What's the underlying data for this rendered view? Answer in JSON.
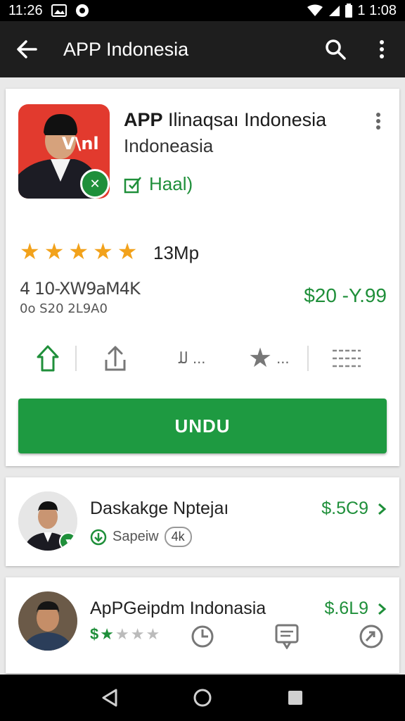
{
  "status_bar": {
    "time_left": "11:26",
    "time_right": "1 1:08"
  },
  "app_bar": {
    "title": "APP Indonesia"
  },
  "app": {
    "name_bold": "APP",
    "name_rest": " Ilinaqsaı Indonesia",
    "subtitle": "Indoneasia",
    "tag": "Haal)",
    "icon_text": "V\\nl",
    "rating_count": "13Mp",
    "downloads": "4 10-XW9aM4K",
    "downloads_sub": "0o S20 2L9A0",
    "price": "$20 -Y.99",
    "actions": [
      {
        "icon": "home-icon",
        "label": ""
      },
      {
        "icon": "share-icon",
        "label": ""
      },
      {
        "icon": "script-icon",
        "label": "ﻟﻠ ..."
      },
      {
        "icon": "star-icon",
        "label": "..."
      },
      {
        "icon": "list-icon",
        "label": ""
      }
    ],
    "install_label": "UNDU"
  },
  "list": [
    {
      "title": "Daskakge Nptejaı",
      "price": "$.5C9",
      "meta_label": "Sapeiw",
      "meta_pill": "4k"
    },
    {
      "title": "ApPGeipdm Indonasia",
      "price": "$.6L9",
      "stars_filled": 2,
      "stars_total": 5
    }
  ],
  "colors": {
    "accent_green": "#1e9a41",
    "star_orange": "#f2a21b",
    "app_bar": "#1e1e1e",
    "icon_red": "#e23a2e"
  }
}
